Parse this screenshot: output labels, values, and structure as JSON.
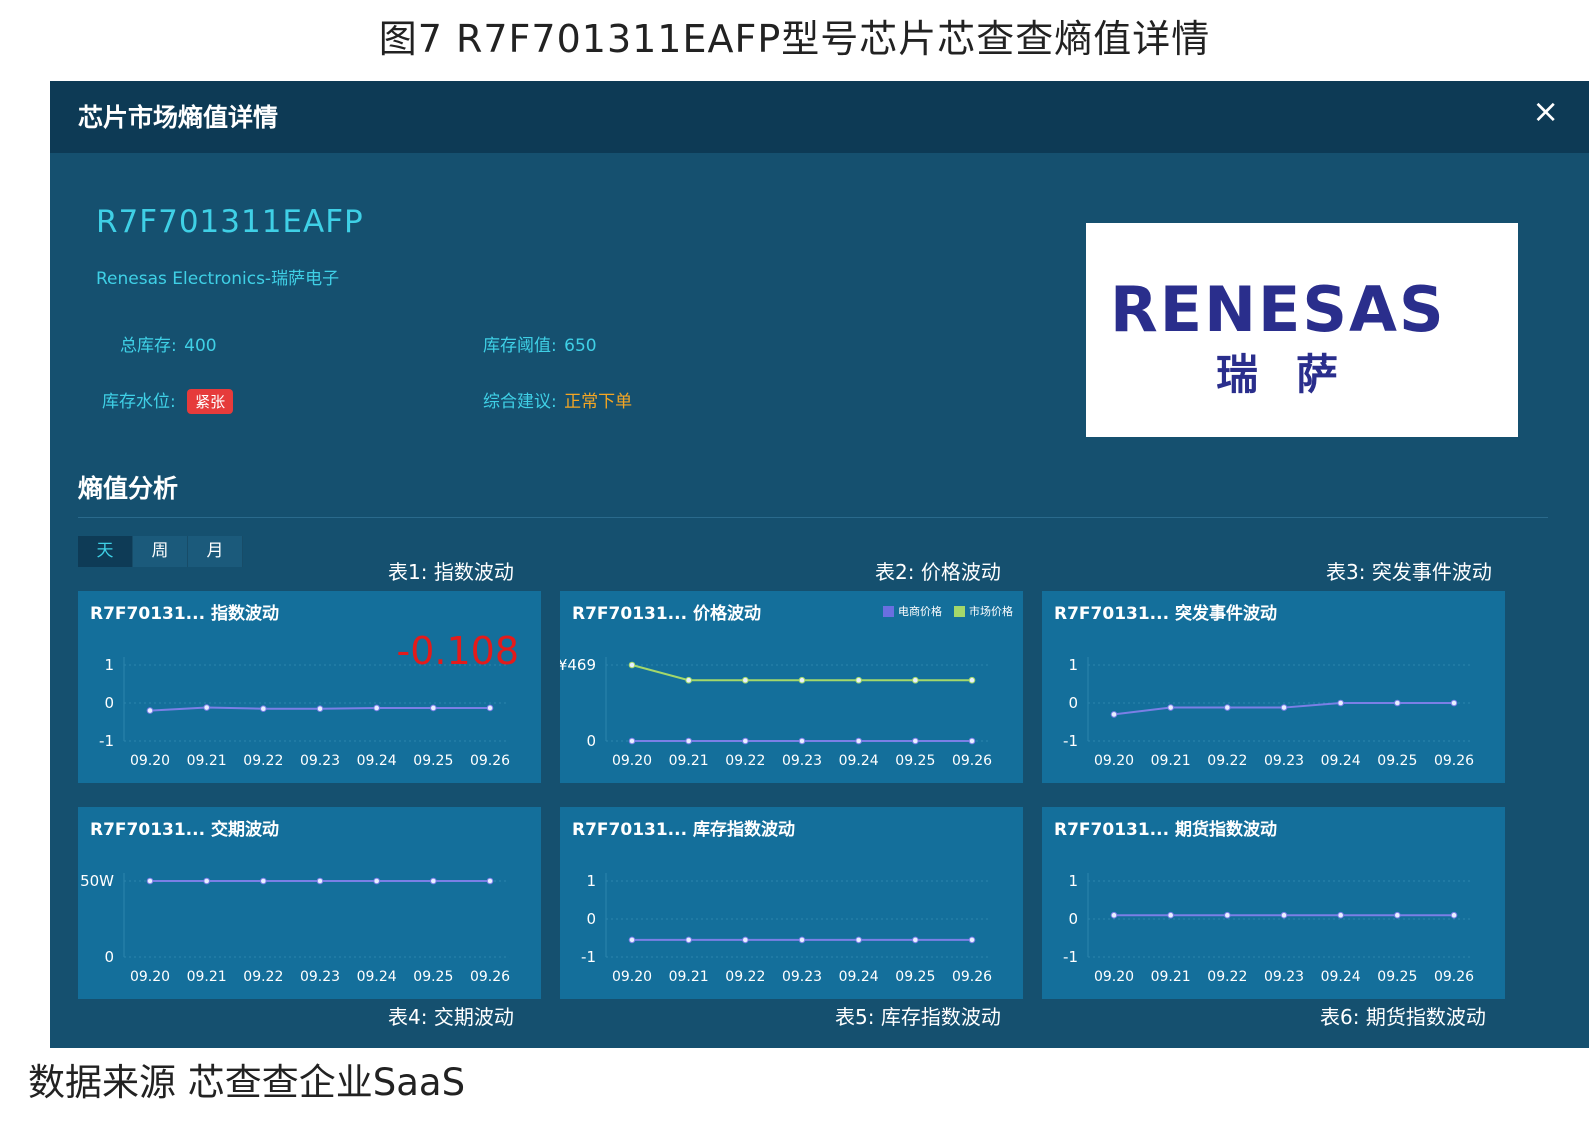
{
  "figure_title": "图7   R7F701311EAFP型号芯片芯查查熵值详情",
  "source_note": "数据来源   芯查查企业SaaS",
  "modal": {
    "title": "芯片市场熵值详情",
    "close_icon": "×",
    "part_number": "R7F701311EAFP",
    "manufacturer": "Renesas Electronics-瑞萨电子",
    "total_stock_label": "总库存:",
    "total_stock_value": "400",
    "stock_threshold_label": "库存阈值:",
    "stock_threshold_value": "650",
    "stock_level_label": "库存水位:",
    "stock_level_value": "紧张",
    "advice_label": "综合建议:",
    "advice_value": "正常下单",
    "logo_text": "RENESAS",
    "logo_cn": "瑞萨",
    "section_title": "熵值分析",
    "tabs": [
      "天",
      "周",
      "月"
    ],
    "captions": [
      "表1: 指数波动",
      "表2: 价格波动",
      "表3: 突发事件波动",
      "表4: 交期波动",
      "表5: 库存指数波动",
      "表6: 期货指数波动"
    ]
  },
  "colors": {
    "line": "#7b7fe6",
    "line2": "#a4d86a",
    "accent": "#3fd0e6",
    "alert": "#e31b1b"
  },
  "chart_data": [
    {
      "type": "line",
      "title": "R7F70131... 指数波动",
      "highlight": "-0.108",
      "x": [
        "09.20",
        "09.21",
        "09.22",
        "09.23",
        "09.24",
        "09.25",
        "09.26"
      ],
      "yticks": [
        "1",
        "0",
        "-1"
      ],
      "ylim": [
        -1,
        1
      ],
      "series": [
        {
          "values": [
            -0.2,
            -0.12,
            -0.15,
            -0.15,
            -0.13,
            -0.13,
            -0.13
          ]
        }
      ]
    },
    {
      "type": "line",
      "title": "R7F70131... 价格波动",
      "x": [
        "09.20",
        "09.21",
        "09.22",
        "09.23",
        "09.24",
        "09.25",
        "09.26"
      ],
      "yticks": [
        "¥469",
        "0"
      ],
      "ylim": [
        0,
        469
      ],
      "series": [
        {
          "name": "电商价格",
          "values": [
            0,
            0,
            0,
            0,
            0,
            0,
            0
          ]
        },
        {
          "name": "市场价格",
          "values": [
            469,
            375,
            375,
            375,
            375,
            375,
            375
          ]
        }
      ]
    },
    {
      "type": "line",
      "title": "R7F70131... 突发事件波动",
      "x": [
        "09.20",
        "09.21",
        "09.22",
        "09.23",
        "09.24",
        "09.25",
        "09.26"
      ],
      "yticks": [
        "1",
        "0",
        "-1"
      ],
      "ylim": [
        -1,
        1
      ],
      "series": [
        {
          "values": [
            -0.3,
            -0.12,
            -0.12,
            -0.12,
            0,
            0,
            0
          ]
        }
      ]
    },
    {
      "type": "line",
      "title": "R7F70131... 交期波动",
      "x": [
        "09.20",
        "09.21",
        "09.22",
        "09.23",
        "09.24",
        "09.25",
        "09.26"
      ],
      "yticks": [
        "50W",
        "0"
      ],
      "ylim": [
        0,
        50
      ],
      "series": [
        {
          "values": [
            50,
            50,
            50,
            50,
            50,
            50,
            50
          ]
        }
      ]
    },
    {
      "type": "line",
      "title": "R7F70131... 库存指数波动",
      "x": [
        "09.20",
        "09.21",
        "09.22",
        "09.23",
        "09.24",
        "09.25",
        "09.26"
      ],
      "yticks": [
        "1",
        "0",
        "-1"
      ],
      "ylim": [
        -1,
        1
      ],
      "series": [
        {
          "values": [
            -0.55,
            -0.55,
            -0.55,
            -0.55,
            -0.55,
            -0.55,
            -0.55
          ]
        }
      ]
    },
    {
      "type": "line",
      "title": "R7F70131... 期货指数波动",
      "x": [
        "09.20",
        "09.21",
        "09.22",
        "09.23",
        "09.24",
        "09.25",
        "09.26"
      ],
      "yticks": [
        "1",
        "0",
        "-1"
      ],
      "ylim": [
        -1,
        1
      ],
      "series": [
        {
          "values": [
            0.1,
            0.1,
            0.1,
            0.1,
            0.1,
            0.1,
            0.1
          ]
        }
      ]
    }
  ]
}
